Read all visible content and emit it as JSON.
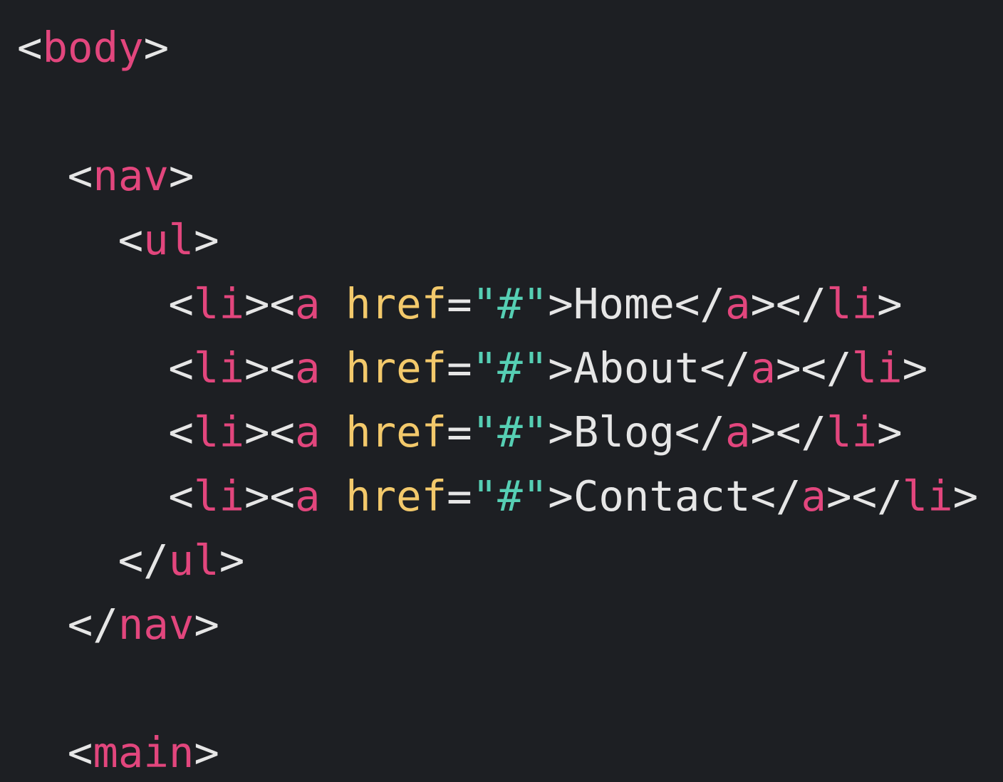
{
  "editor": {
    "theme": {
      "background": "#1d1f23",
      "punct": "#e6e6e6",
      "tag": "#e2467d",
      "attr": "#f3c96b",
      "string": "#56cfb4",
      "text": "#e6e6e6"
    },
    "lines": [
      {
        "indent": 0,
        "tokens": [
          {
            "type": "punct",
            "text": "<"
          },
          {
            "type": "tag",
            "text": "body"
          },
          {
            "type": "punct",
            "text": ">"
          }
        ]
      },
      {
        "indent": 0,
        "tokens": []
      },
      {
        "indent": 2,
        "tokens": [
          {
            "type": "punct",
            "text": "<"
          },
          {
            "type": "tag",
            "text": "nav"
          },
          {
            "type": "punct",
            "text": ">"
          }
        ]
      },
      {
        "indent": 4,
        "tokens": [
          {
            "type": "punct",
            "text": "<"
          },
          {
            "type": "tag",
            "text": "ul"
          },
          {
            "type": "punct",
            "text": ">"
          }
        ]
      },
      {
        "indent": 6,
        "tokens": [
          {
            "type": "punct",
            "text": "<"
          },
          {
            "type": "tag",
            "text": "li"
          },
          {
            "type": "punct",
            "text": "><"
          },
          {
            "type": "tag",
            "text": "a"
          },
          {
            "type": "punct",
            "text": " "
          },
          {
            "type": "attr",
            "text": "href"
          },
          {
            "type": "punct",
            "text": "="
          },
          {
            "type": "str",
            "text": "\"#\""
          },
          {
            "type": "punct",
            "text": ">"
          },
          {
            "type": "text",
            "text": "Home"
          },
          {
            "type": "punct",
            "text": "</"
          },
          {
            "type": "tag",
            "text": "a"
          },
          {
            "type": "punct",
            "text": "></"
          },
          {
            "type": "tag",
            "text": "li"
          },
          {
            "type": "punct",
            "text": ">"
          }
        ]
      },
      {
        "indent": 6,
        "tokens": [
          {
            "type": "punct",
            "text": "<"
          },
          {
            "type": "tag",
            "text": "li"
          },
          {
            "type": "punct",
            "text": "><"
          },
          {
            "type": "tag",
            "text": "a"
          },
          {
            "type": "punct",
            "text": " "
          },
          {
            "type": "attr",
            "text": "href"
          },
          {
            "type": "punct",
            "text": "="
          },
          {
            "type": "str",
            "text": "\"#\""
          },
          {
            "type": "punct",
            "text": ">"
          },
          {
            "type": "text",
            "text": "About"
          },
          {
            "type": "punct",
            "text": "</"
          },
          {
            "type": "tag",
            "text": "a"
          },
          {
            "type": "punct",
            "text": "></"
          },
          {
            "type": "tag",
            "text": "li"
          },
          {
            "type": "punct",
            "text": ">"
          }
        ]
      },
      {
        "indent": 6,
        "tokens": [
          {
            "type": "punct",
            "text": "<"
          },
          {
            "type": "tag",
            "text": "li"
          },
          {
            "type": "punct",
            "text": "><"
          },
          {
            "type": "tag",
            "text": "a"
          },
          {
            "type": "punct",
            "text": " "
          },
          {
            "type": "attr",
            "text": "href"
          },
          {
            "type": "punct",
            "text": "="
          },
          {
            "type": "str",
            "text": "\"#\""
          },
          {
            "type": "punct",
            "text": ">"
          },
          {
            "type": "text",
            "text": "Blog"
          },
          {
            "type": "punct",
            "text": "</"
          },
          {
            "type": "tag",
            "text": "a"
          },
          {
            "type": "punct",
            "text": "></"
          },
          {
            "type": "tag",
            "text": "li"
          },
          {
            "type": "punct",
            "text": ">"
          }
        ]
      },
      {
        "indent": 6,
        "tokens": [
          {
            "type": "punct",
            "text": "<"
          },
          {
            "type": "tag",
            "text": "li"
          },
          {
            "type": "punct",
            "text": "><"
          },
          {
            "type": "tag",
            "text": "a"
          },
          {
            "type": "punct",
            "text": " "
          },
          {
            "type": "attr",
            "text": "href"
          },
          {
            "type": "punct",
            "text": "="
          },
          {
            "type": "str",
            "text": "\"#\""
          },
          {
            "type": "punct",
            "text": ">"
          },
          {
            "type": "text",
            "text": "Contact"
          },
          {
            "type": "punct",
            "text": "</"
          },
          {
            "type": "tag",
            "text": "a"
          },
          {
            "type": "punct",
            "text": "></"
          },
          {
            "type": "tag",
            "text": "li"
          },
          {
            "type": "punct",
            "text": ">"
          }
        ]
      },
      {
        "indent": 4,
        "tokens": [
          {
            "type": "punct",
            "text": "</"
          },
          {
            "type": "tag",
            "text": "ul"
          },
          {
            "type": "punct",
            "text": ">"
          }
        ]
      },
      {
        "indent": 2,
        "tokens": [
          {
            "type": "punct",
            "text": "</"
          },
          {
            "type": "tag",
            "text": "nav"
          },
          {
            "type": "punct",
            "text": ">"
          }
        ]
      },
      {
        "indent": 0,
        "tokens": []
      },
      {
        "indent": 2,
        "tokens": [
          {
            "type": "punct",
            "text": "<"
          },
          {
            "type": "tag",
            "text": "main"
          },
          {
            "type": "punct",
            "text": ">"
          }
        ]
      }
    ]
  }
}
